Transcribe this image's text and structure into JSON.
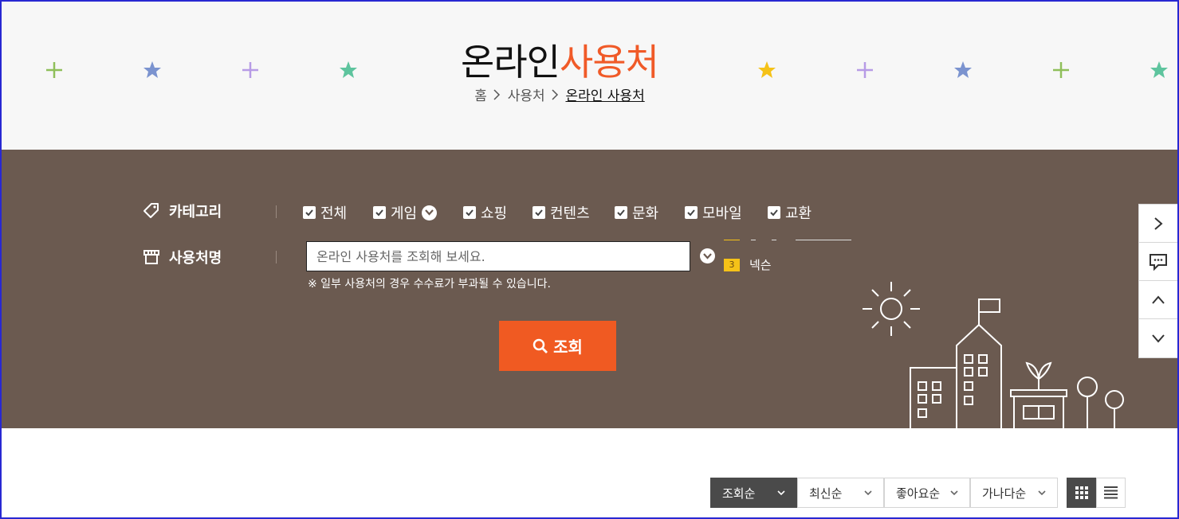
{
  "header": {
    "title_main": "온라인",
    "title_accent": "사용처",
    "breadcrumb": [
      "홈",
      "사용처",
      "온라인 사용처"
    ]
  },
  "search": {
    "category_label": "카테고리",
    "categories": [
      "전체",
      "게임",
      "쇼핑",
      "컨텐츠",
      "문화",
      "모바일",
      "교환"
    ],
    "store_label": "사용처명",
    "placeholder": "온라인 사용처를 조회해 보세요.",
    "note": "※ 일부 사용처의 경우 수수료가 부과될 수 있습니다.",
    "button_label": "조회"
  },
  "ranking": {
    "rank": "3",
    "name": "넥슨"
  },
  "sort_options": [
    "조회순",
    "최신순",
    "좋아요순",
    "가나다순"
  ],
  "colors": {
    "accent": "#f05a28",
    "band": "#6b5a50",
    "badge": "#f5c218"
  },
  "icons": {
    "category": "tag-icon",
    "store": "store-icon",
    "search": "search-icon",
    "quick_menu": [
      "chevron-right-icon",
      "chat-icon",
      "chevron-up-icon",
      "chevron-down-icon"
    ],
    "view": [
      "grid-view-icon",
      "list-view-icon"
    ]
  }
}
